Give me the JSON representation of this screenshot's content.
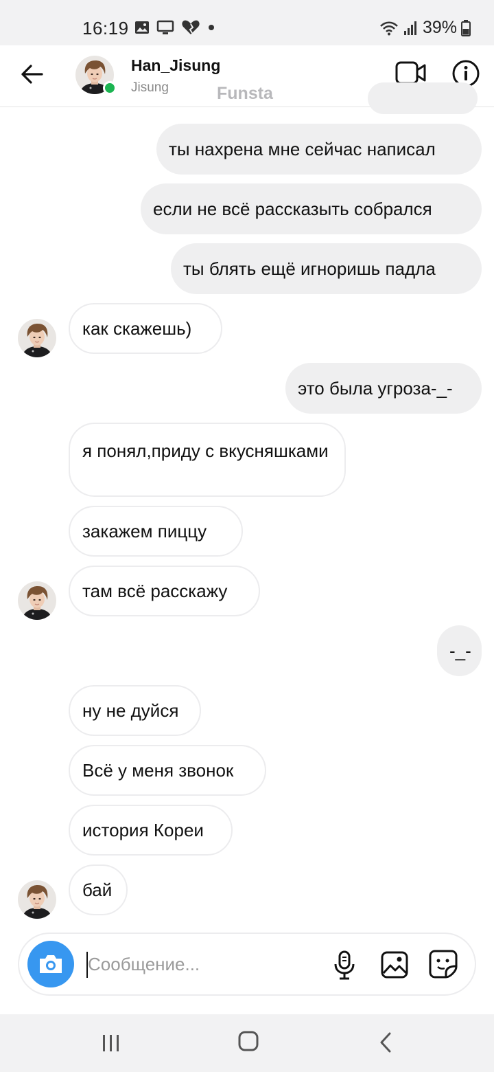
{
  "status_bar": {
    "time": "16:19",
    "battery": "39%"
  },
  "header": {
    "name": "Han_Jisung",
    "subtitle": "Jisung",
    "tag": "Funsta"
  },
  "messages": [
    {
      "side": "out",
      "text": "ты нахрена мне сейчас написал"
    },
    {
      "side": "out",
      "text": "если не всё рассказыть собрался"
    },
    {
      "side": "out",
      "text": "ты блять ещё игноришь падла"
    },
    {
      "side": "in",
      "text": "как скажешь)"
    },
    {
      "side": "out",
      "text": "это была угроза-_-"
    },
    {
      "side": "in",
      "text": "я понял,приду с вкусняшками"
    },
    {
      "side": "in",
      "text": "закажем пиццу"
    },
    {
      "side": "in",
      "text": "там всё расскажу"
    },
    {
      "side": "out",
      "text": "-_-"
    },
    {
      "side": "in",
      "text": "ну не дуйся"
    },
    {
      "side": "in",
      "text": "Всё у меня звонок"
    },
    {
      "side": "in",
      "text": "история Кореи"
    },
    {
      "side": "in",
      "text": "бай"
    }
  ],
  "composer": {
    "placeholder": "Сообщение...",
    "value": ""
  },
  "colors": {
    "accent": "#3797f0",
    "online": "#1bb451",
    "outgoing_bubble": "#efeff0"
  }
}
